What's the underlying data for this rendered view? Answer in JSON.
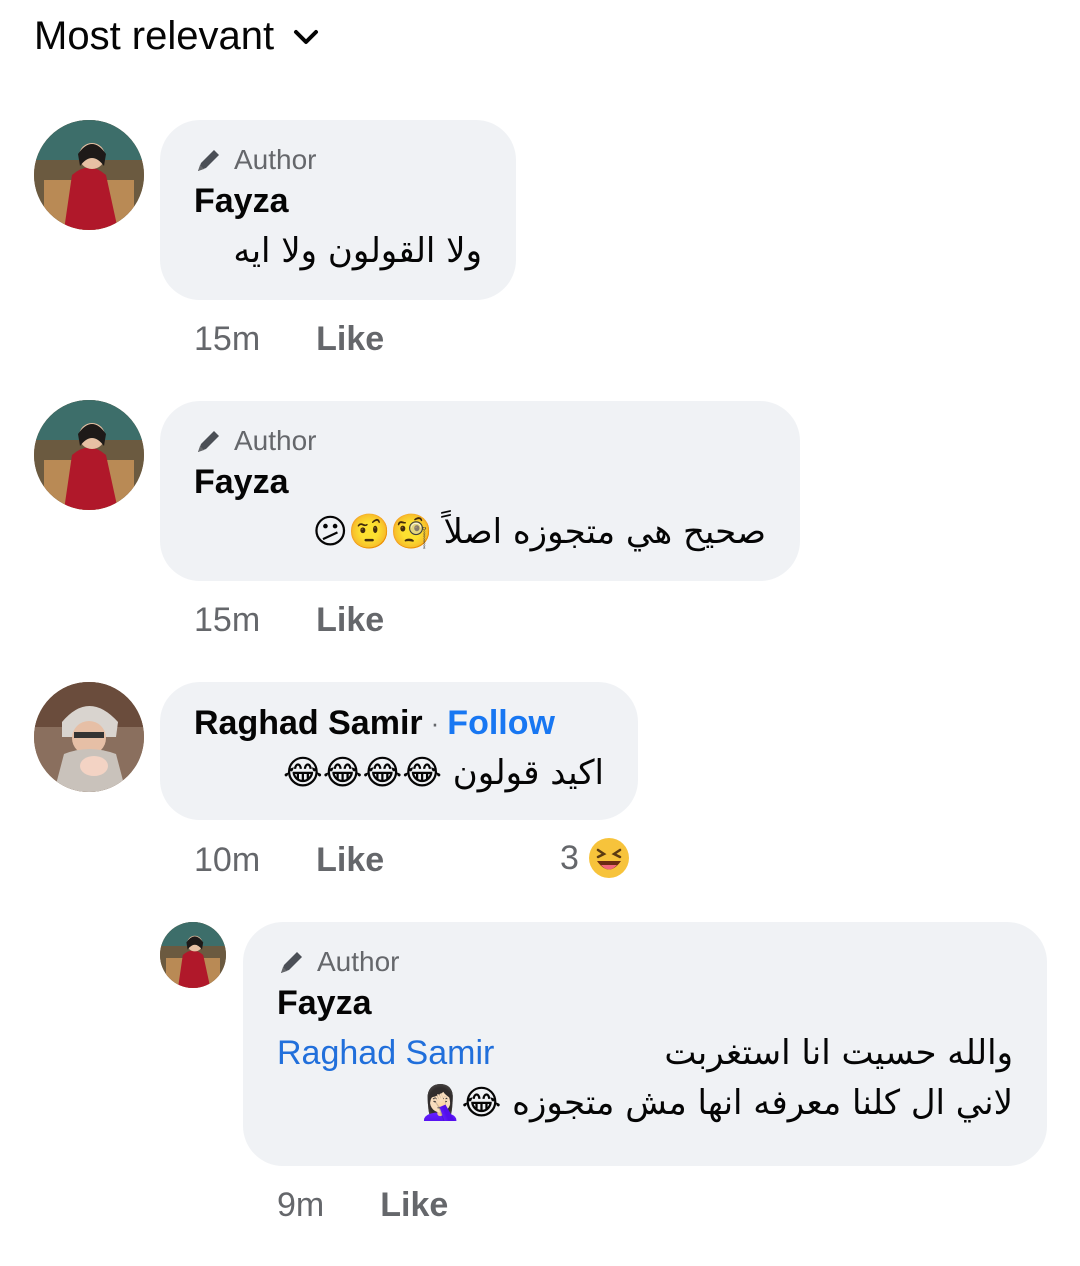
{
  "sort": {
    "label": "Most relevant"
  },
  "comments": [
    {
      "author_badge": "Author",
      "name": "Fayza",
      "text": "ولا القولون ولا ايه",
      "time": "15m",
      "like": "Like"
    },
    {
      "author_badge": "Author",
      "name": "Fayza",
      "text": "صحيح هي متجوزه اصلاً 🧐🤨😕",
      "time": "15m",
      "like": "Like"
    },
    {
      "name": "Raghad Samir",
      "separator": "·",
      "follow": "Follow",
      "text": "اكيد قولون 😂😂😂😂",
      "time": "10m",
      "like": "Like",
      "reaction_count": "3",
      "reaction_icon": "laughing-face"
    },
    {
      "author_badge": "Author",
      "name": "Fayza",
      "mention": "Raghad Samir",
      "text_line1": "والله حسيت انا استغربت",
      "text_line2": "لاني ال كلنا معرفه انها مش متجوزه 😂🤦🏻‍♀️",
      "time": "9m",
      "like": "Like"
    }
  ],
  "colors": {
    "bubble": "#f0f2f5",
    "link": "#1877f2",
    "meta": "#65676b",
    "text": "#050505"
  }
}
